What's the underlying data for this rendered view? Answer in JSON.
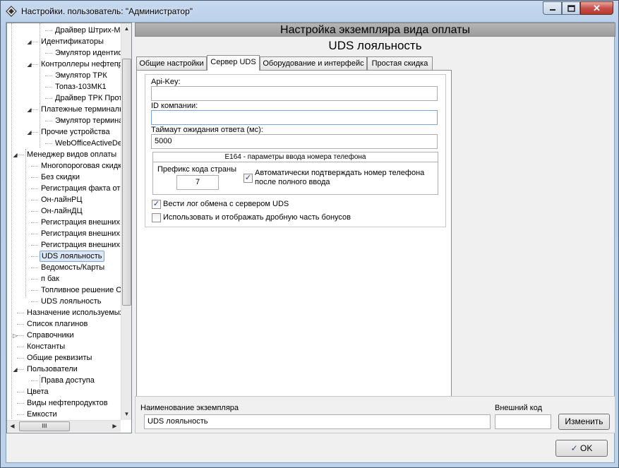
{
  "window": {
    "title": "Настройки. пользователь: \"Администратор\""
  },
  "tree": {
    "items": [
      {
        "label": "Драйвер Штрих-М"
      },
      {
        "label": "Идентификаторы"
      },
      {
        "label": "Эмулятор идентиф"
      },
      {
        "label": "Контроллеры нефтепр"
      },
      {
        "label": "Эмулятор ТРК"
      },
      {
        "label": "Топаз-103МК1"
      },
      {
        "label": "Драйвер ТРК Прот"
      },
      {
        "label": "Платежные терминалы"
      },
      {
        "label": "Эмулятор термина"
      },
      {
        "label": "Прочие устройства"
      },
      {
        "label": "WebOfficeActiveDe"
      },
      {
        "label": "Менеджер видов оплаты"
      },
      {
        "label": "Многопороговая скидк"
      },
      {
        "label": "Без скидки"
      },
      {
        "label": "Регистрация факта от"
      },
      {
        "label": "Он-лайнРЦ"
      },
      {
        "label": "Он-лайнДЦ"
      },
      {
        "label": "Регистрация внешних"
      },
      {
        "label": "Регистрация внешних"
      },
      {
        "label": "Регистрация внешних"
      },
      {
        "label": "UDS лояльность"
      },
      {
        "label": "Ведомость/Карты"
      },
      {
        "label": "п бак"
      },
      {
        "label": "Топливное решение ОЛ"
      },
      {
        "label": "UDS лояльность"
      },
      {
        "label": "Назначение используемых"
      },
      {
        "label": "Список плагинов"
      },
      {
        "label": "Справочники"
      },
      {
        "label": "Константы"
      },
      {
        "label": "Общие реквизиты"
      },
      {
        "label": "Пользователи"
      },
      {
        "label": "Права доступа"
      },
      {
        "label": "Цвета"
      },
      {
        "label": "Виды нефтепродуктов"
      },
      {
        "label": "Емкости"
      }
    ],
    "hscroll_grip": "III"
  },
  "header": {
    "title": "Настройка экземпляра вида оплаты",
    "subtitle": "UDS лояльность"
  },
  "tabs": [
    {
      "label": "Общие настройки"
    },
    {
      "label": "Сервер UDS"
    },
    {
      "label": "Оборудование и интерфейс"
    },
    {
      "label": "Простая скидка"
    }
  ],
  "form": {
    "api_key_label": "Api-Key:",
    "api_key_value": "",
    "company_id_label": "ID компании:",
    "company_id_value": "",
    "timeout_label": "Таймаут ожидания ответа (мс):",
    "timeout_value": "5000",
    "e164_title": "E164 - параметры ввода номера телефона",
    "country_prefix_label": "Префикс кода страны",
    "country_prefix_value": "7",
    "auto_confirm_label": "Автоматически подтверждать номер телефона после полного ввода",
    "auto_confirm_checked": true,
    "log_label": "Вести лог обмена с сервером UDS",
    "log_checked": true,
    "fraction_label": "Использовать и отображать дробную часть бонусов",
    "fraction_checked": false
  },
  "bottom": {
    "name_label": "Наименование экземпляра",
    "name_value": "UDS лояльность",
    "ext_code_label": "Внешний код",
    "ext_code_value": "",
    "change_button": "Изменить"
  },
  "footer": {
    "ok_button": "OK"
  }
}
